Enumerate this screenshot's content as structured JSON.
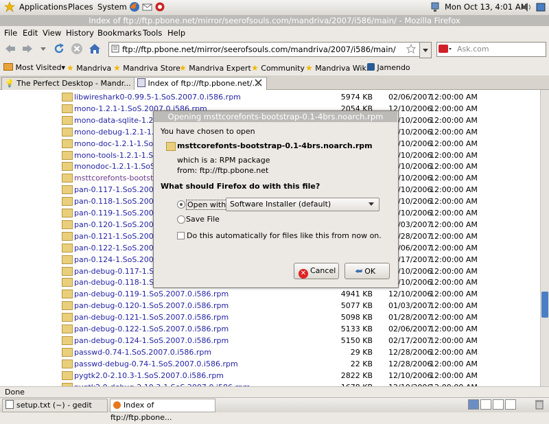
{
  "panel": {
    "applications": "Applications",
    "places": "Places",
    "system": "System",
    "clock": "Mon Oct 13,  4:01 AM"
  },
  "window": {
    "title": "Index of ftp://ftp.pbone.net/mirror/seerofsouls.com/mandriva/2007/i586/main/ - Mozilla Firefox"
  },
  "menubar": [
    "File",
    "Edit",
    "View",
    "History",
    "Bookmarks",
    "Tools",
    "Help"
  ],
  "nav": {
    "url": "ftp://ftp.pbone.net/mirror/seerofsouls.com/mandriva/2007/i586/main/",
    "search_placeholder": "Ask.com"
  },
  "bookmarks": [
    "Most Visited",
    "Mandriva",
    "Mandriva Store",
    "Mandriva Expert",
    "Community",
    "Mandriva Wiki",
    "Jamendo"
  ],
  "tabs": [
    {
      "label": "The Perfect Desktop - Mandr..."
    },
    {
      "label": "Index of ftp://ftp.pbone.net/..."
    }
  ],
  "files": [
    {
      "name": "libwireshark0-0.99.5-1.SoS.2007.0.i586.rpm",
      "size": "5974 KB",
      "date": "02/06/2007",
      "time": "12:00:00 AM"
    },
    {
      "name": "mono-1.2.1-1.SoS.2007.0.i586.rpm",
      "size": "2054 KB",
      "date": "12/10/2006",
      "time": "12:00:00 AM"
    },
    {
      "name": "mono-data-sqlite-1.2.1",
      "size": "",
      "date": "12/10/2006",
      "time": "12:00:00 AM"
    },
    {
      "name": "mono-debug-1.2.1-1.S",
      "size": "",
      "date": "12/10/2006",
      "time": "12:00:00 AM"
    },
    {
      "name": "mono-doc-1.2.1-1.SoS",
      "size": "",
      "date": "12/10/2006",
      "time": "12:00:00 AM"
    },
    {
      "name": "mono-tools-1.2.1-1.So",
      "size": "",
      "date": "12/10/2006",
      "time": "12:00:00 AM"
    },
    {
      "name": "monodoc-1.2.1-1.SoS.",
      "size": "",
      "date": "12/10/2006",
      "time": "12:00:00 AM"
    },
    {
      "name": "msttcorefonts-bootstra",
      "size": "",
      "date": "12/10/2006",
      "time": "12:00:00 AM"
    },
    {
      "name": "pan-0.117-1.SoS.2007",
      "size": "",
      "date": "12/10/2006",
      "time": "12:00:00 AM"
    },
    {
      "name": "pan-0.118-1.SoS.2007",
      "size": "",
      "date": "12/10/2006",
      "time": "12:00:00 AM"
    },
    {
      "name": "pan-0.119-1.SoS.2007",
      "size": "",
      "date": "12/10/2006",
      "time": "12:00:00 AM"
    },
    {
      "name": "pan-0.120-1.SoS.2007",
      "size": "",
      "date": "01/03/2007",
      "time": "12:00:00 AM"
    },
    {
      "name": "pan-0.121-1.SoS.2007",
      "size": "",
      "date": "01/28/2007",
      "time": "12:00:00 AM"
    },
    {
      "name": "pan-0.122-1.SoS.2007",
      "size": "",
      "date": "02/06/2007",
      "time": "12:00:00 AM"
    },
    {
      "name": "pan-0.124-1.SoS.2007",
      "size": "",
      "date": "02/17/2007",
      "time": "12:00:00 AM"
    },
    {
      "name": "pan-debug-0.117-1.SoS",
      "size": "",
      "date": "12/10/2006",
      "time": "12:00:00 AM"
    },
    {
      "name": "pan-debug-0.118-1.SoS",
      "size": "",
      "date": "12/10/2006",
      "time": "12:00:00 AM"
    },
    {
      "name": "pan-debug-0.119-1.SoS.2007.0.i586.rpm",
      "size": "4941 KB",
      "date": "12/10/2006",
      "time": "12:00:00 AM"
    },
    {
      "name": "pan-debug-0.120-1.SoS.2007.0.i586.rpm",
      "size": "5077 KB",
      "date": "01/03/2007",
      "time": "12:00:00 AM"
    },
    {
      "name": "pan-debug-0.121-1.SoS.2007.0.i586.rpm",
      "size": "5098 KB",
      "date": "01/28/2007",
      "time": "12:00:00 AM"
    },
    {
      "name": "pan-debug-0.122-1.SoS.2007.0.i586.rpm",
      "size": "5133 KB",
      "date": "02/06/2007",
      "time": "12:00:00 AM"
    },
    {
      "name": "pan-debug-0.124-1.SoS.2007.0.i586.rpm",
      "size": "5150 KB",
      "date": "02/17/2007",
      "time": "12:00:00 AM"
    },
    {
      "name": "passwd-0.74-1.SoS.2007.0.i586.rpm",
      "size": "29 KB",
      "date": "12/28/2006",
      "time": "12:00:00 AM"
    },
    {
      "name": "passwd-debug-0.74-1.SoS.2007.0.i586.rpm",
      "size": "22 KB",
      "date": "12/28/2006",
      "time": "12:00:00 AM"
    },
    {
      "name": "pygtk2.0-2.10.3-1.SoS.2007.0.i586.rpm",
      "size": "2822 KB",
      "date": "12/10/2006",
      "time": "12:00:00 AM"
    },
    {
      "name": "pygtk2.0-debug-2.10.3-1.SoS.2007.0.i586.rpm",
      "size": "1678 KB",
      "date": "12/10/2006",
      "time": "12:00:00 AM"
    }
  ],
  "dialog": {
    "title": "Opening msttcorefonts-bootstrap-0.1-4brs.noarch.rpm",
    "intro": "You have chosen to open",
    "filename": "msttcorefonts-bootstrap-0.1-4brs.noarch.rpm",
    "which_is": "which is a:  RPM package",
    "from": "from:  ftp://ftp.pbone.net",
    "question": "What should Firefox do with this file?",
    "open_with_label": "Open with",
    "open_with_value": "Software Installer (default)",
    "save_file_label": "Save File",
    "auto_label": "Do this automatically for files like this from now on.",
    "cancel": "Cancel",
    "ok": "OK"
  },
  "status": "Done",
  "taskbar": [
    {
      "label": "setup.txt (~) - gedit"
    },
    {
      "label": "Index of ftp://ftp.pbone..."
    }
  ],
  "colors": {
    "link": "#2323a5",
    "visited": "#6a3a8a",
    "dialog_bg": "#ece9e4",
    "titlebar_bg": "#bdbbb8"
  }
}
